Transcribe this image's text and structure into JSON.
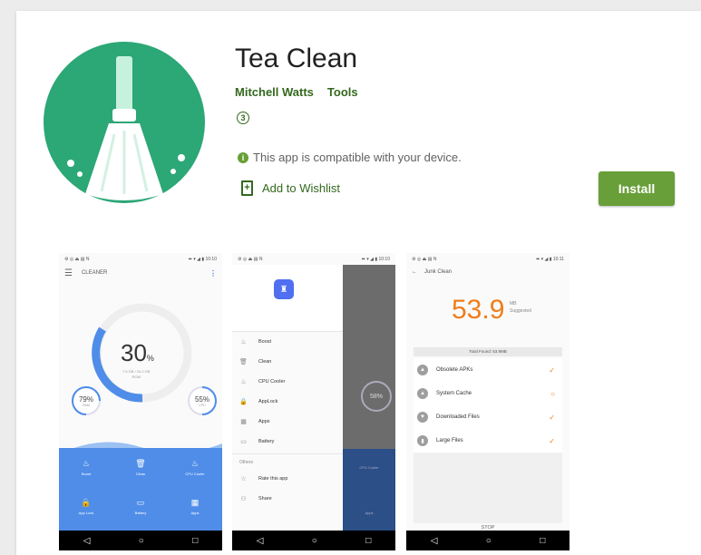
{
  "app": {
    "title": "Tea Clean",
    "developer": "Mitchell Watts",
    "category": "Tools",
    "rating_badge": "3",
    "compat_icon": "i",
    "compat_text": "This app is compatible with your device.",
    "wishlist_label": "Add to Wishlist",
    "install_label": "Install",
    "icon": "broom-icon",
    "colors": {
      "accent": "#689f38",
      "link": "#33691e",
      "icon_bg": "#2fb07d"
    }
  },
  "screenshots": [
    {
      "status_left": "⚙ ◎ ⏏ ▤ N",
      "status_right": "⬌ ▾ ◢ ▮ 10:10",
      "toolbar_title": "CLEANER",
      "percent": "30",
      "percent_unit": "%",
      "storage_line1": "7.6 GB / 24.0 GB",
      "storage_line2": "ROM",
      "left_gauge": "79%",
      "left_gauge_sub": "RAM",
      "right_gauge": "55%",
      "right_gauge_sub": "CPU",
      "grid": [
        {
          "icon": "♨",
          "label": "Boost"
        },
        {
          "icon": "🗑",
          "label": "Clean"
        },
        {
          "icon": "♨",
          "label": "CPU Cooler"
        },
        {
          "icon": "🔒",
          "label": "App Lock"
        },
        {
          "icon": "▭",
          "label": "Battery"
        },
        {
          "icon": "▦",
          "label": "Apps"
        }
      ]
    },
    {
      "status_left": "⚙ ◎ ⏏ ▤ N",
      "status_right": "⬌ ▾ ◢ ▮ 10:10",
      "items": [
        {
          "icon": "♨",
          "label": "Boost"
        },
        {
          "icon": "🗑",
          "label": "Clean"
        },
        {
          "icon": "♨",
          "label": "CPU Cooler"
        },
        {
          "icon": "🔒",
          "label": "AppLock"
        },
        {
          "icon": "▦",
          "label": "Apps"
        },
        {
          "icon": "▭",
          "label": "Battery"
        }
      ],
      "section": "Others",
      "other_items": [
        {
          "icon": "☆",
          "label": "Rate this app"
        },
        {
          "icon": "⚇",
          "label": "Share"
        }
      ],
      "overlay_gauge": "58%",
      "overlay_label1": "CPU Cooler",
      "overlay_label2": "Apps"
    },
    {
      "status_left": "⚙ ◎ ⏏ ▤ N",
      "status_right": "⬌ ▾ ◢ ▮ 10:11",
      "toolbar_title": "Junk Clean",
      "size": "53.9",
      "size_unit": "MB",
      "size_sub": "Suggested",
      "total": "Total Found: 53.9MB",
      "rows": [
        {
          "label": "Obsolete APKs",
          "check": "✓"
        },
        {
          "label": "System Cache",
          "check": "○"
        },
        {
          "label": "Downloaded Files",
          "check": "✓"
        },
        {
          "label": "Large Files",
          "check": "✓"
        }
      ],
      "stop": "STOP"
    }
  ],
  "navbar": {
    "back": "◁",
    "home": "○",
    "recent": "□"
  }
}
